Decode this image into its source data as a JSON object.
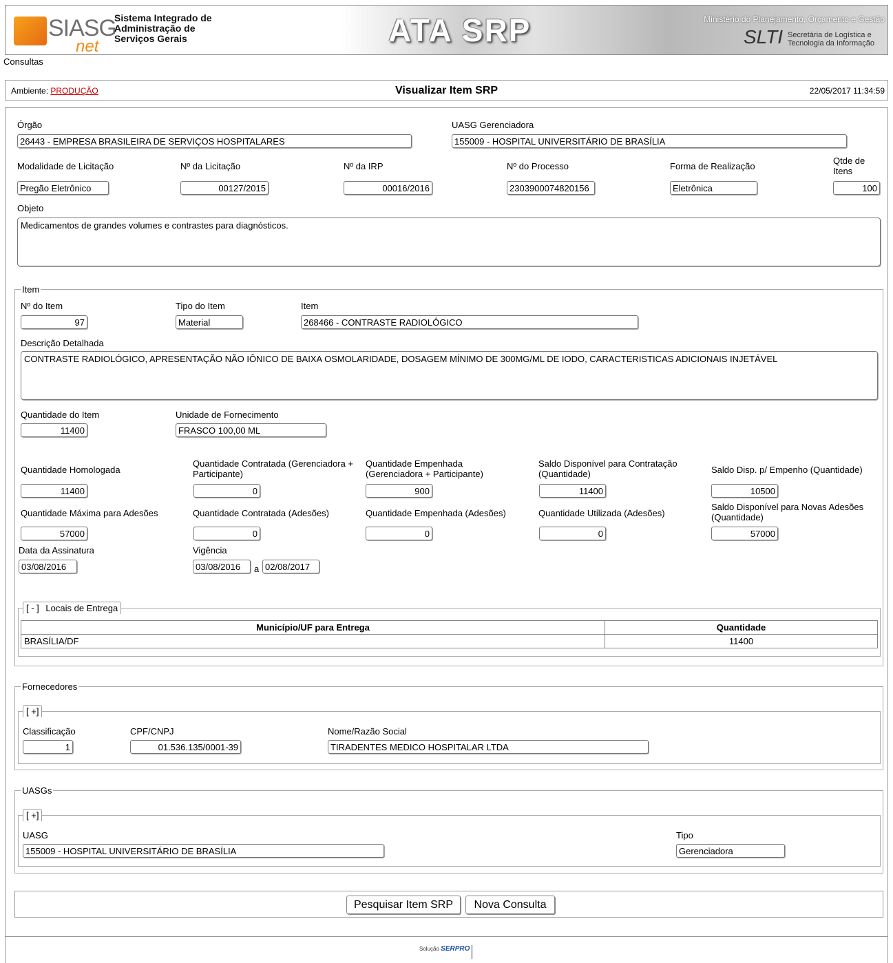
{
  "banner": {
    "logo_text": "SIASG",
    "logo_sub": "net",
    "system_name": "Sistema Integrado de\nAdministração de\nServiços Gerais",
    "title": "ATA SRP",
    "ministry": "Ministério do Planejamento, Orçamento e Gestão",
    "slti_logo": "SLTI",
    "slti_desc": "Secretária de Logística e\nTecnologia da Informação"
  },
  "nav": {
    "consultas": "Consultas"
  },
  "statusbar": {
    "ambiente_label": "Ambiente:",
    "ambiente_value": "PRODUÇÃO",
    "title": "Visualizar Item SRP",
    "datetime": "22/05/2017 11:34:59"
  },
  "header": {
    "orgao_label": "Órgão",
    "orgao": "26443 - EMPRESA BRASILEIRA DE SERVIÇOS HOSPITALARES",
    "uasg_label": "UASG Gerenciadora",
    "uasg": "155009 - HOSPITAL UNIVERSITÁRIO DE BRASÍLIA",
    "modalidade_label": "Modalidade de Licitação",
    "modalidade": "Pregão Eletrônico",
    "licitacao_label": "Nº da Licitação",
    "licitacao": "00127/2015",
    "irp_label": "Nº da IRP",
    "irp": "00016/2016",
    "processo_label": "Nº do Processo",
    "processo": "2303900074820156",
    "forma_label": "Forma de Realização",
    "forma": "Eletrônica",
    "qtde_label": "Qtde de Itens",
    "qtde": "100",
    "objeto_label": "Objeto",
    "objeto": "Medicamentos de  grandes volumes e contrastes para diagnósticos."
  },
  "item": {
    "legend": "Item",
    "numero_label": "Nº do Item",
    "numero": "97",
    "tipo_label": "Tipo do Item",
    "tipo": "Material",
    "item_label": "Item",
    "item": "268466 - CONTRASTE RADIOLÓGICO",
    "descricao_label": "Descrição Detalhada",
    "descricao": "CONTRASTE RADIOLÓGICO, APRESENTAÇÃO NÃO IÔNICO DE BAIXA OSMOLARIDADE, DOSAGEM MÍNIMO DE 300MG/ML DE IODO, CARACTERISTICAS ADICIONAIS INJETÁVEL",
    "quantidade_label": "Quantidade do Item",
    "quantidade": "11400",
    "unidade_label": "Unidade de Fornecimento",
    "unidade": "FRASCO 100,00 ML",
    "homologada_label": "Quantidade Homologada",
    "homologada": "11400",
    "contratada_label": "Quantidade Contratada (Gerenciadora + Participante)",
    "contratada": "0",
    "empenhada_label": "Quantidade Empenhada (Gerenciadora + Participante)",
    "empenhada": "900",
    "saldo_contratacao_label": "Saldo Disponível para Contratação (Quantidade)",
    "saldo_contratacao": "11400",
    "saldo_empenho_label": "Saldo Disp. p/ Empenho (Quantidade)",
    "saldo_empenho": "10500",
    "max_adesoes_label": "Quantidade Máxima para Adesões",
    "max_adesoes": "57000",
    "contratada_adesoes_label": "Quantidade Contratada (Adesões)",
    "contratada_adesoes": "0",
    "empenhada_adesoes_label": "Quantidade Empenhada (Adesões)",
    "empenhada_adesoes": "0",
    "utilizada_adesoes_label": "Quantidade Utilizada (Adesões)",
    "utilizada_adesoes": "0",
    "saldo_novas_label": "Saldo Disponível para Novas Adesões (Quantidade)",
    "saldo_novas": "57000",
    "assinatura_label": "Data da Assinatura",
    "assinatura": "03/08/2016",
    "vigencia_label": "Vigência",
    "vigencia_inicio": "03/08/2016",
    "vigencia_sep": "a",
    "vigencia_fim": "02/08/2017"
  },
  "locais": {
    "toggle": "[ - ]",
    "legend": "Locais de Entrega",
    "columns": [
      "Município/UF para Entrega",
      "Quantidade"
    ],
    "rows": [
      [
        "BRASÍLIA/DF",
        "11400"
      ]
    ]
  },
  "fornecedores": {
    "legend": "Fornecedores",
    "toggle": "[ +]",
    "classificacao_label": "Classificação",
    "classificacao": "1",
    "cnpj_label": "CPF/CNPJ",
    "cnpj": "01.536.135/0001-39",
    "razao_label": "Nome/Razão Social",
    "razao": "TIRADENTES MEDICO HOSPITALAR LTDA"
  },
  "uasgs": {
    "legend": "UASGs",
    "toggle": "[ +]",
    "uasg_label": "UASG",
    "uasg": "155009 - HOSPITAL UNIVERSITÁRIO DE BRASÍLIA",
    "tipo_label": "Tipo",
    "tipo": "Gerenciadora"
  },
  "buttons": {
    "pesquisar": "Pesquisar Item SRP",
    "nova": "Nova Consulta"
  },
  "footer": {
    "solucao": "Solução",
    "serpro": "SERPRO"
  }
}
